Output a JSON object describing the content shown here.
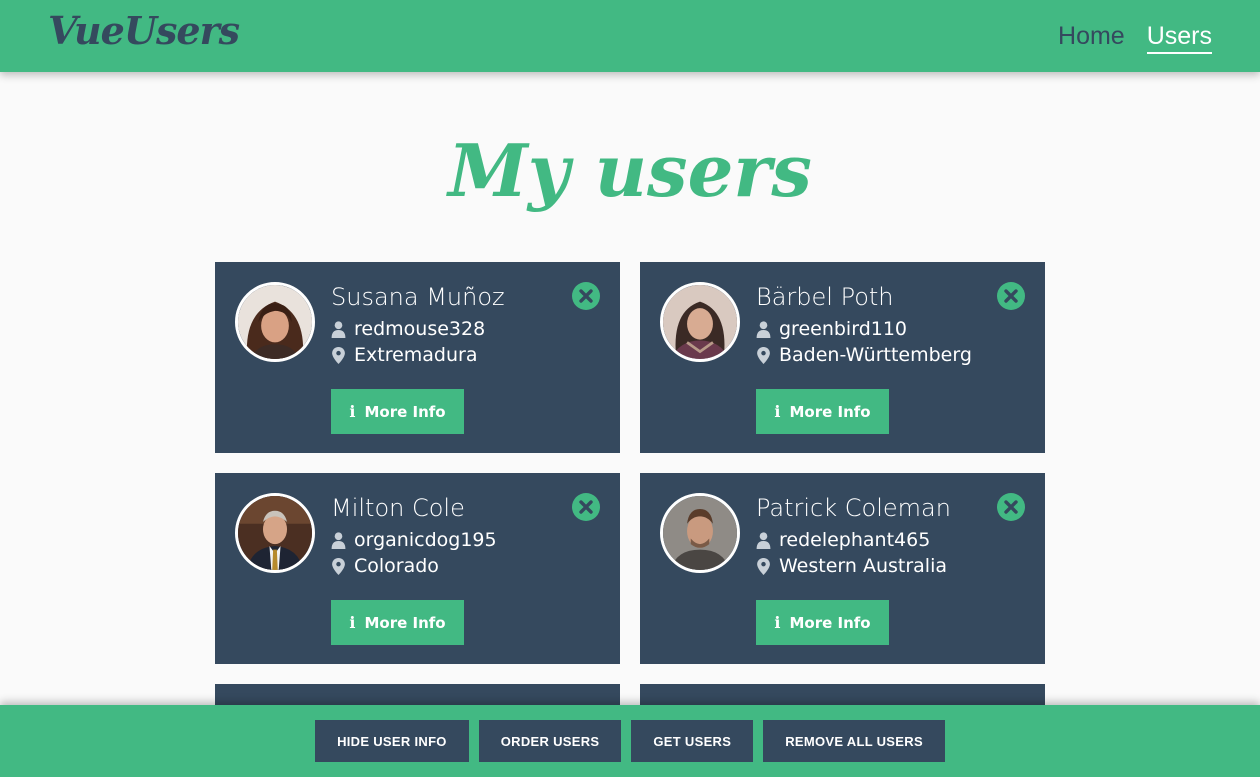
{
  "app": {
    "logo": "VueUsers"
  },
  "nav": [
    {
      "label": "Home",
      "active": false
    },
    {
      "label": "Users",
      "active": true
    }
  ],
  "page": {
    "title": "My users"
  },
  "users": [
    {
      "name": "Susana Muñoz",
      "username": "redmouse328",
      "location": "Extremadura",
      "more_label": "More Info"
    },
    {
      "name": "Bärbel Poth",
      "username": "greenbird110",
      "location": "Baden-Württemberg",
      "more_label": "More Info"
    },
    {
      "name": "Milton Cole",
      "username": "organicdog195",
      "location": "Colorado",
      "more_label": "More Info"
    },
    {
      "name": "Patrick Coleman",
      "username": "redelephant465",
      "location": "Western Australia",
      "more_label": "More Info"
    }
  ],
  "footer": {
    "buttons": [
      "HIDE USER INFO",
      "ORDER USERS",
      "GET USERS",
      "REMOVE ALL USERS"
    ]
  },
  "colors": {
    "accent": "#42b983",
    "card": "#35495e",
    "background": "#fafafa"
  },
  "icons": {
    "user": "user-icon",
    "location": "map-marker-icon",
    "remove": "times-circle-icon",
    "info": "info-icon"
  }
}
